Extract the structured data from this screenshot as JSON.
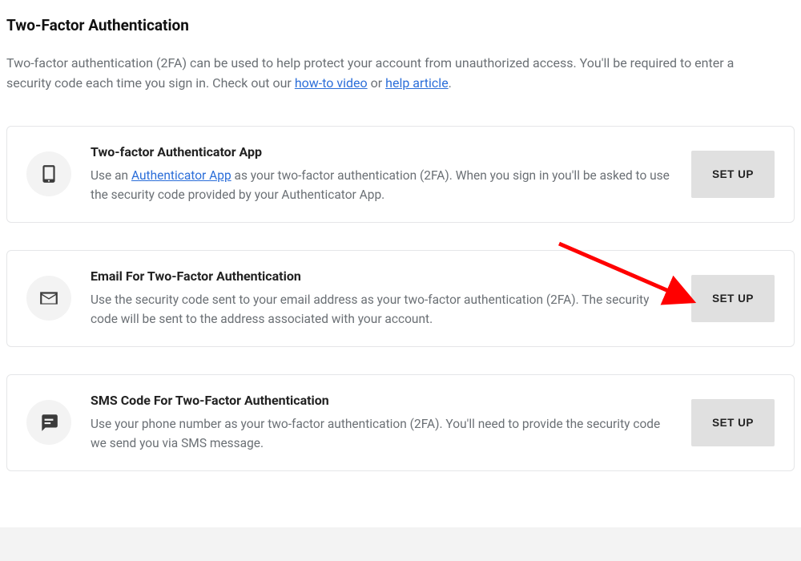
{
  "page": {
    "title": "Two-Factor Authentication",
    "intro_before": "Two-factor authentication (2FA) can be used to help protect your account from unauthorized access. You'll be required to enter a security code each time you sign in. Check out our ",
    "howto_link": "how-to video",
    "intro_middle": " or ",
    "help_link": "help article",
    "intro_after": "."
  },
  "methods": {
    "app": {
      "title": "Two-factor Authenticator App",
      "desc_before": "Use an ",
      "desc_link": "Authenticator App",
      "desc_after": " as your two-factor authentication (2FA). When you sign in you'll be asked to use the security code provided by your Authenticator App.",
      "button": "SET UP"
    },
    "email": {
      "title": "Email For Two-Factor Authentication",
      "desc": "Use the security code sent to your email address as your two-factor authentication (2FA). The security code will be sent to the address associated with your account.",
      "button": "SET UP"
    },
    "sms": {
      "title": "SMS Code For Two-Factor Authentication",
      "desc": "Use your phone number as your two-factor authentication (2FA). You'll need to provide the security code we send you via SMS message.",
      "button": "SET UP"
    }
  },
  "annotation": {
    "arrow_color": "#ff0000"
  }
}
